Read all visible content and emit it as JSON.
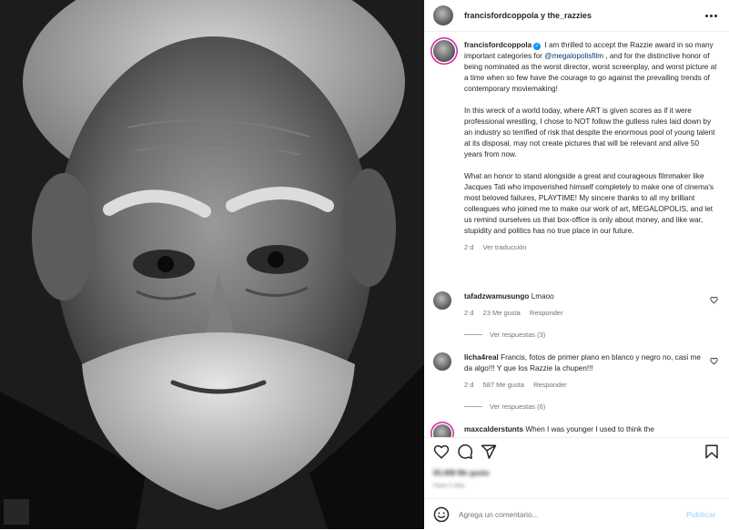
{
  "header": {
    "title": "francisfordcoppola y the_razzies"
  },
  "caption": {
    "username": "francisfordcoppola",
    "paragraphs": [
      {
        "before": "I am thrilled to accept the Razzie award in so many important categories for ",
        "mention": "@megalopolisfilm",
        "after": " , and for the distinctive honor of being nominated as the worst director, worst screenplay, and worst picture at a time when so few have the courage to go against the prevailing trends of contemporary moviemaking!"
      },
      {
        "text": "In this wreck of a world today, where ART is given scores as if it were professional wrestling, I chose to NOT follow the gutless rules laid down by an industry so terrified of risk that despite the enormous pool of young talent at its disposal, may not create pictures that will be relevant and alive 50 years from now."
      },
      {
        "text": "What an honor to stand alongside a great and courageous filmmaker like Jacques Tati who impoverished himself completely to make one of cinema's most beloved failures, PLAYTIME! My sincere thanks to all my brilliant colleagues who joined me to make our work of art, MEGALOPOLIS, and let us remind ourselves us that box-office is only about money, and like war, stupidity and politics has no true place in our future."
      }
    ],
    "time": "2 d",
    "translate": "Ver traducción"
  },
  "comments": [
    {
      "username": "tafadzwamusungo",
      "text": "Lmaoo",
      "time": "2 d",
      "likes": "23 Me gusta",
      "reply": "Responder",
      "replies": "Ver respuestas (3)"
    },
    {
      "username": "licha4real",
      "text": "Francis, fotos de primer plano en blanco y negro no, casi me da algo!!! Y que los Razzie la chupen!!!",
      "time": "2 d",
      "likes": "587 Me gusta",
      "reply": "Responder",
      "replies": "Ver respuestas (6)"
    },
    {
      "username": "maxcalderstunts",
      "text": "When I was younger I used to think the"
    }
  ],
  "stats": {
    "likes": "93.408 Me gusta",
    "date": "Hace 2 días"
  },
  "composer": {
    "placeholder": "Agrega un comentario...",
    "post": "Publicar"
  },
  "colors": {
    "accent": "#0095f6",
    "mention": "#00376b",
    "muted": "#737373",
    "story_ring": "#d6249f"
  }
}
